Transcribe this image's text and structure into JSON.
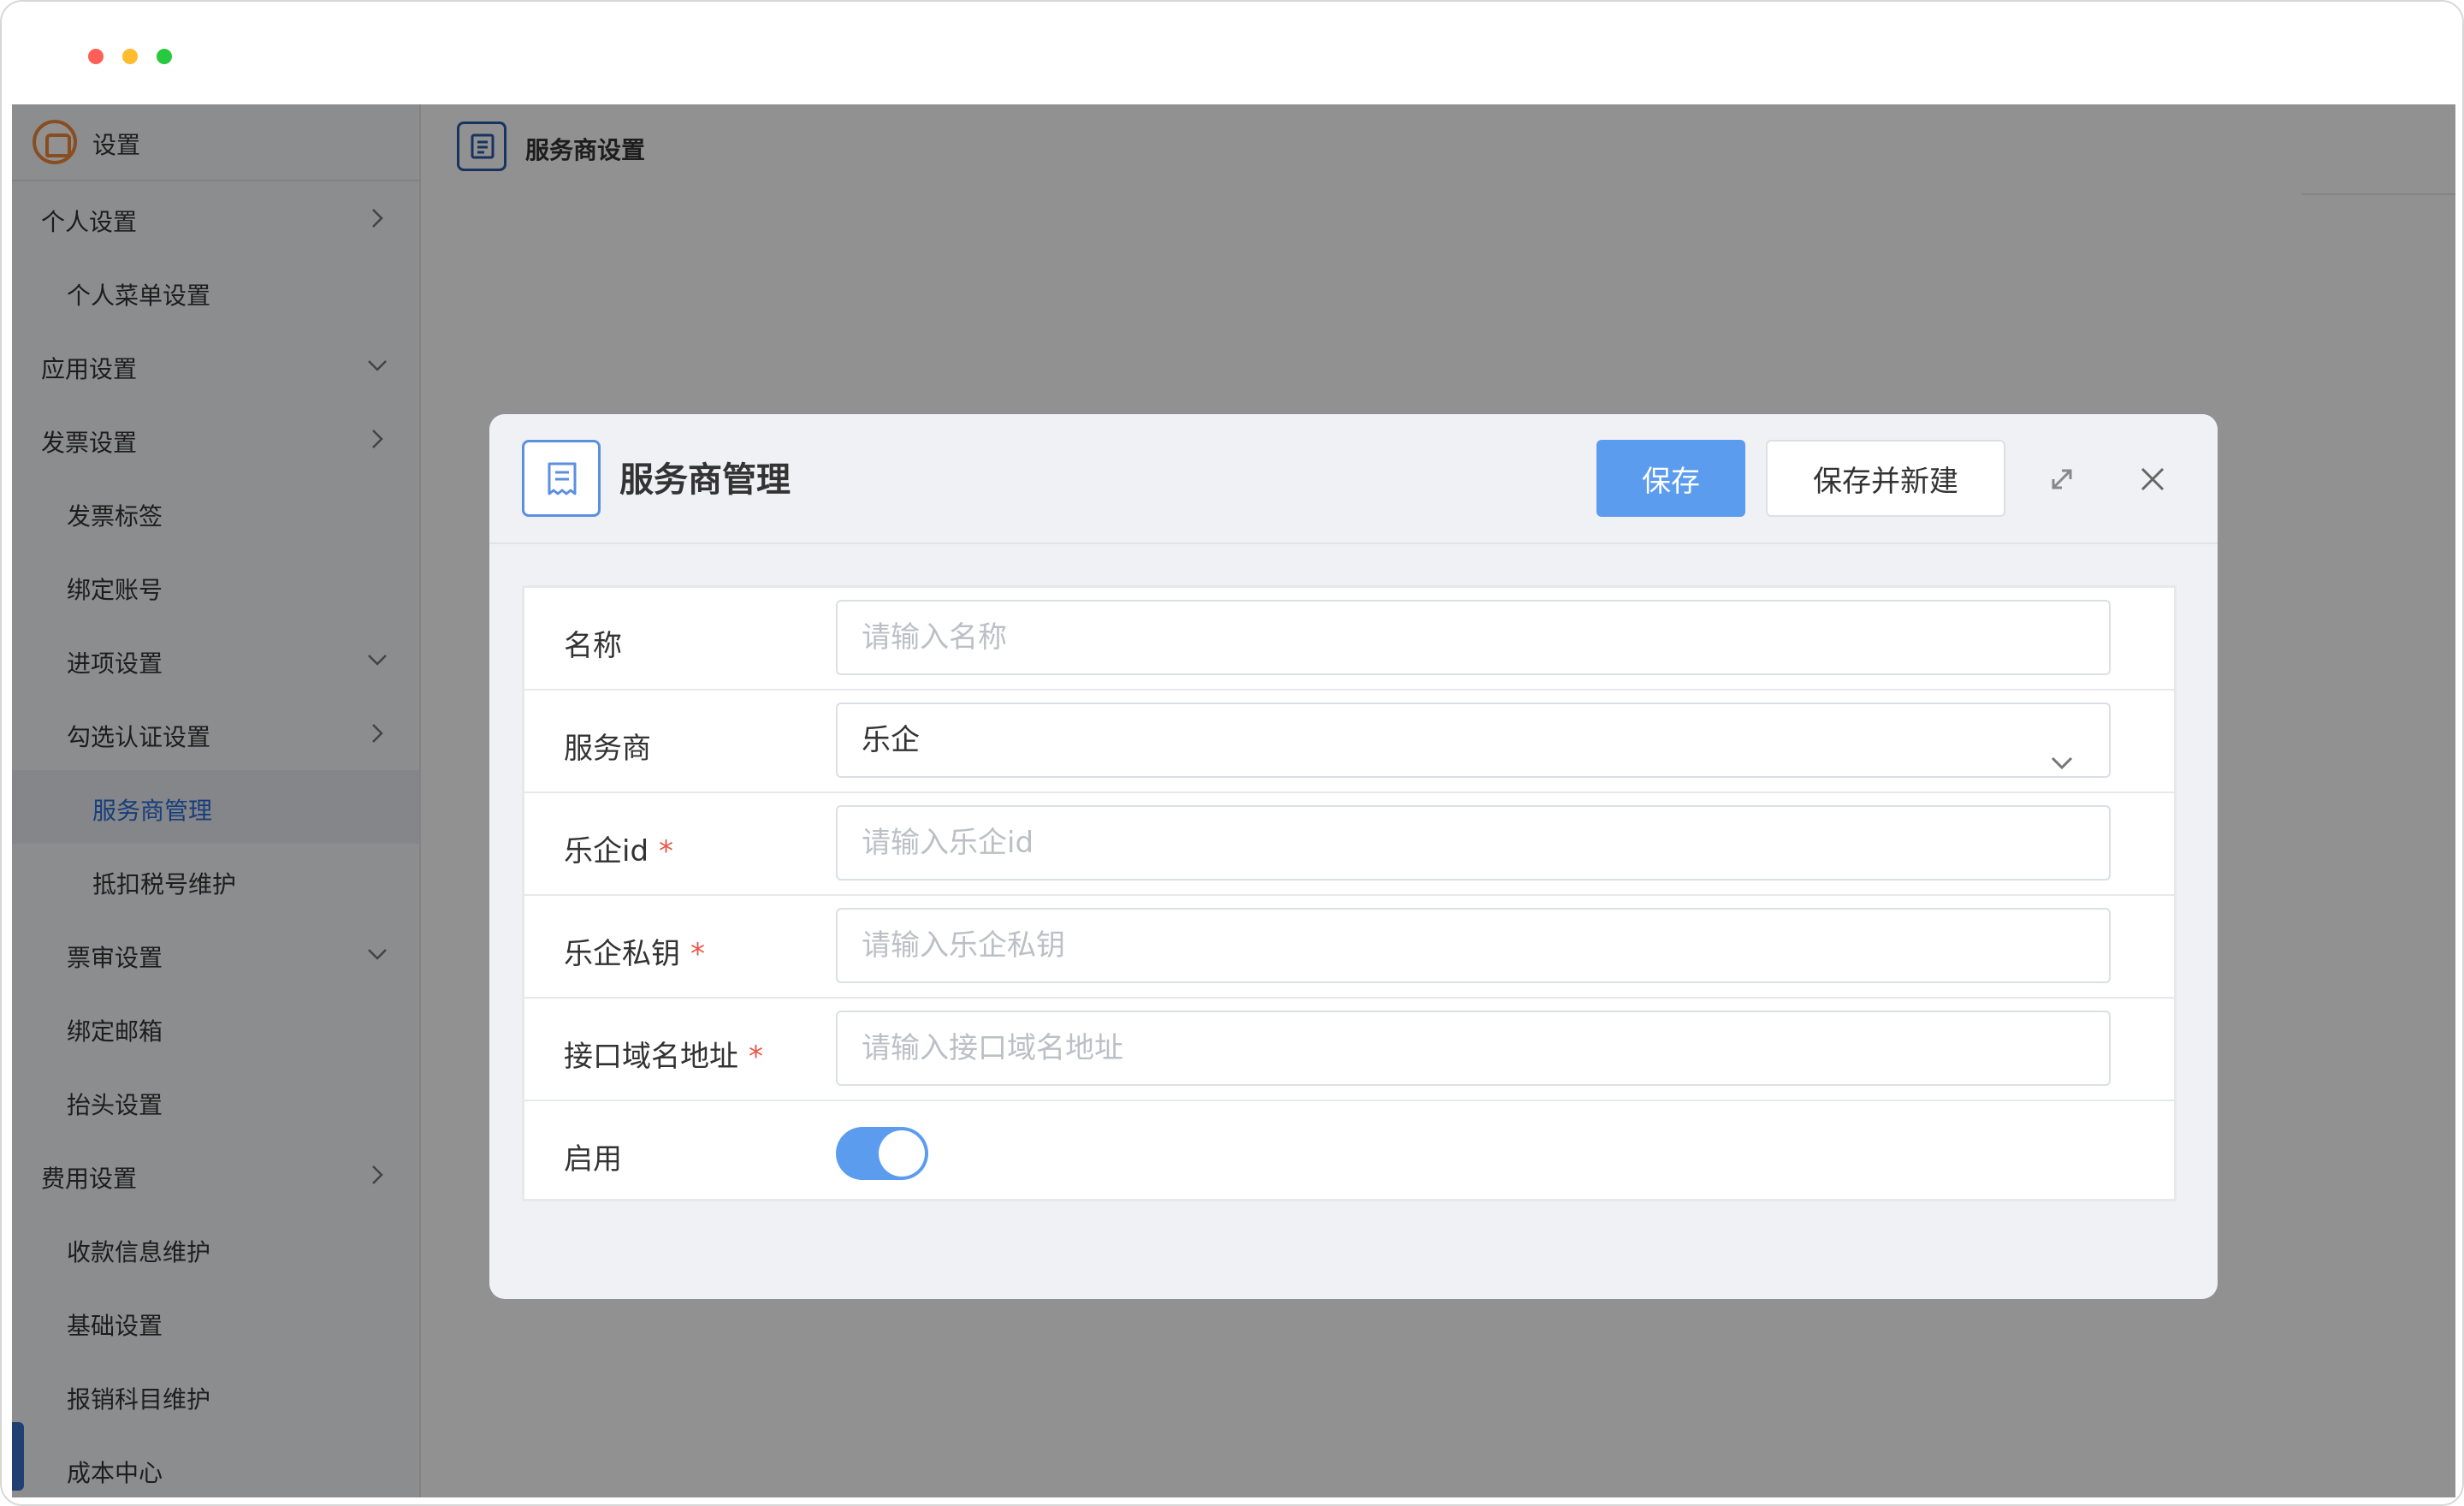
{
  "sidebar": {
    "title": "设置",
    "items": [
      {
        "label": "个人设置",
        "level": 0,
        "chevron": "right"
      },
      {
        "label": "个人菜单设置",
        "level": 1,
        "chevron": ""
      },
      {
        "label": "应用设置",
        "level": 0,
        "chevron": "down"
      },
      {
        "label": "发票设置",
        "level": 0,
        "chevron": "right"
      },
      {
        "label": "发票标签",
        "level": 1,
        "chevron": ""
      },
      {
        "label": "绑定账号",
        "level": 1,
        "chevron": ""
      },
      {
        "label": "进项设置",
        "level": 1,
        "chevron": "down"
      },
      {
        "label": "勾选认证设置",
        "level": 1,
        "chevron": "right"
      },
      {
        "label": "服务商管理",
        "level": 2,
        "chevron": "",
        "active": true
      },
      {
        "label": "抵扣税号维护",
        "level": 2,
        "chevron": ""
      },
      {
        "label": "票审设置",
        "level": 1,
        "chevron": "down"
      },
      {
        "label": "绑定邮箱",
        "level": 1,
        "chevron": ""
      },
      {
        "label": "抬头设置",
        "level": 1,
        "chevron": ""
      },
      {
        "label": "费用设置",
        "level": 0,
        "chevron": "right"
      },
      {
        "label": "收款信息维护",
        "level": 1,
        "chevron": ""
      },
      {
        "label": "基础设置",
        "level": 1,
        "chevron": ""
      },
      {
        "label": "报销科目维护",
        "level": 1,
        "chevron": ""
      },
      {
        "label": "成本中心",
        "level": 1,
        "chevron": ""
      }
    ]
  },
  "main": {
    "page_title": "服务商设置"
  },
  "modal": {
    "title": "服务商管理",
    "save_label": "保存",
    "save_new_label": "保存并新建",
    "fields": {
      "name": {
        "label": "名称",
        "placeholder": "请输入名称"
      },
      "provider": {
        "label": "服务商",
        "value": "乐企"
      },
      "leqi_id": {
        "label": "乐企id",
        "required_mark": "*",
        "placeholder": "请输入乐企id"
      },
      "leqi_key": {
        "label": "乐企私钥",
        "required_mark": "*",
        "placeholder": "请输入乐企私钥"
      },
      "domain": {
        "label": "接口域名地址",
        "required_mark": "*",
        "placeholder": "请输入接口域名地址"
      },
      "enabled": {
        "label": "启用",
        "on": true
      }
    }
  },
  "colors": {
    "primary": "#5b9cef",
    "required": "#e8584a",
    "active_text": "#2a6dd6",
    "logo": "#f0893a"
  },
  "icons": {
    "window_controls": [
      "close-dot-icon",
      "minimize-dot-icon",
      "zoom-dot-icon"
    ],
    "sidebar_logo": "app-logo-icon",
    "page": "document-icon",
    "modal": "receipt-icon",
    "expand": "expand-icon",
    "close": "close-icon",
    "select": "chevron-down-icon"
  }
}
